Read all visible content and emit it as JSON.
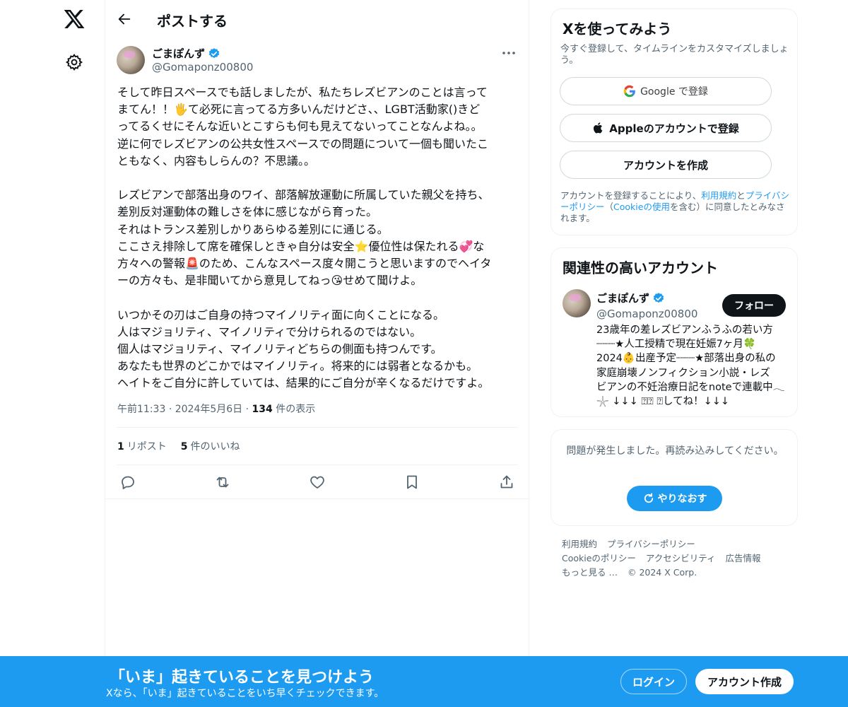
{
  "header": {
    "title": "ポストする"
  },
  "post": {
    "author_name": "ごまぽんず",
    "author_handle": "@Gomaponz00800",
    "text": "そして昨日スペースでも話しましたが、私たちレズビアンのことは言って\nまてん！！🖐て必死に言ってる方多いんだけどさ、、LGBT活動家()きど\nってるくせにそんな近いとこすらも何も見えてないってことなんよね。。\n逆に何でレズビアンの公共女性スペースでの問題について一個も聞いたこ\nともなく、内容もしらんの？不思議。。\n\nレズビアンで部落出身のワイ、部落解放運動に所属していた親父を持ち、\n差別反対運動体の難しさを体に感じながら育った。\nそれはトランス差別しかりあらゆる差別にに通じる。\nここさえ排除して席を確保しときゃ自分は安全⭐優位性は保たれる💞な\n方々への警報🚨のため、こんなスペース度々開こうと思いますのでヘイタ\nーの方々も、是非聞いてから意見してねっ😘せめて聞けよ。\n\nいつかその刃はご自身の持つマイノリティ面に向くことになる。\n人はマジョリティ、マイノリティで分けられるのではない。\n個人はマジョリティ、マイノリティどちらの側面も持つんです。\nあなたも世界のどこかではマイノリティ。将来的には弱者となるかも。\nヘイトをご自分に許していては、結果的にご自分が辛くなるだけですよ。",
    "time": "午前11:33",
    "date": "2024年5月6日",
    "views_count": "134",
    "views_label": "件の表示",
    "reposts_count": "1",
    "reposts_label": "リポスト",
    "likes_count": "5",
    "likes_label": "件のいいね",
    "sep": "·"
  },
  "signup_card": {
    "title": "Xを使ってみよう",
    "subtitle": "今すぐ登録して、タイムラインをカスタマイズしましょう。",
    "google_label": "Google で登録",
    "apple_label": "Appleのアカウントで登録",
    "create_label": "アカウントを作成",
    "terms_prefix": "アカウントを登録することにより、",
    "terms_link1": "利用規約",
    "terms_and": "と",
    "terms_link2": "プライバシーポリシー",
    "terms_paren_open": "（",
    "terms_link3": "Cookieの使用",
    "terms_paren_close": "を含む）に同意したとみなされます。"
  },
  "related": {
    "title": "関連性の高いアカウント",
    "name": "ごまぽんず",
    "handle": "@Gomaponz00800",
    "follow_label": "フォロー",
    "bio": "23歳年の差レズビアンふうふの若い方\n┈┈┈★人工授精で現在妊娠7ヶ月🍀\n2024👶出産予定┈┈┈★部落出身の私の\n家庭崩壊ノンフィクション小説・レズ\nビアンの不妊治療日記をnoteで連載中𓂃\n𓇼 ↓↓↓ ⍰⍰ ⍰してね！↓↓↓"
  },
  "error_card": {
    "message": "問題が発生しました。再読み込みしてください。",
    "retry_label": "やりなおす"
  },
  "footer": {
    "links_row1": [
      "利用規約",
      "プライバシーポリシー"
    ],
    "links_row2": [
      "Cookieのポリシー",
      "アクセシビリティ",
      "広告情報"
    ],
    "more": "もっと見る …",
    "copyright": "© 2024 X Corp."
  },
  "banner": {
    "title": "「いま」起きていることを見つけよう",
    "subtitle": "Xなら、「いま」起きていることをいち早くチェックできます。",
    "login_label": "ログイン",
    "signup_label": "アカウント作成"
  },
  "colors": {
    "accent": "#1d9bf0",
    "text": "#0f1419",
    "muted": "#536471"
  }
}
